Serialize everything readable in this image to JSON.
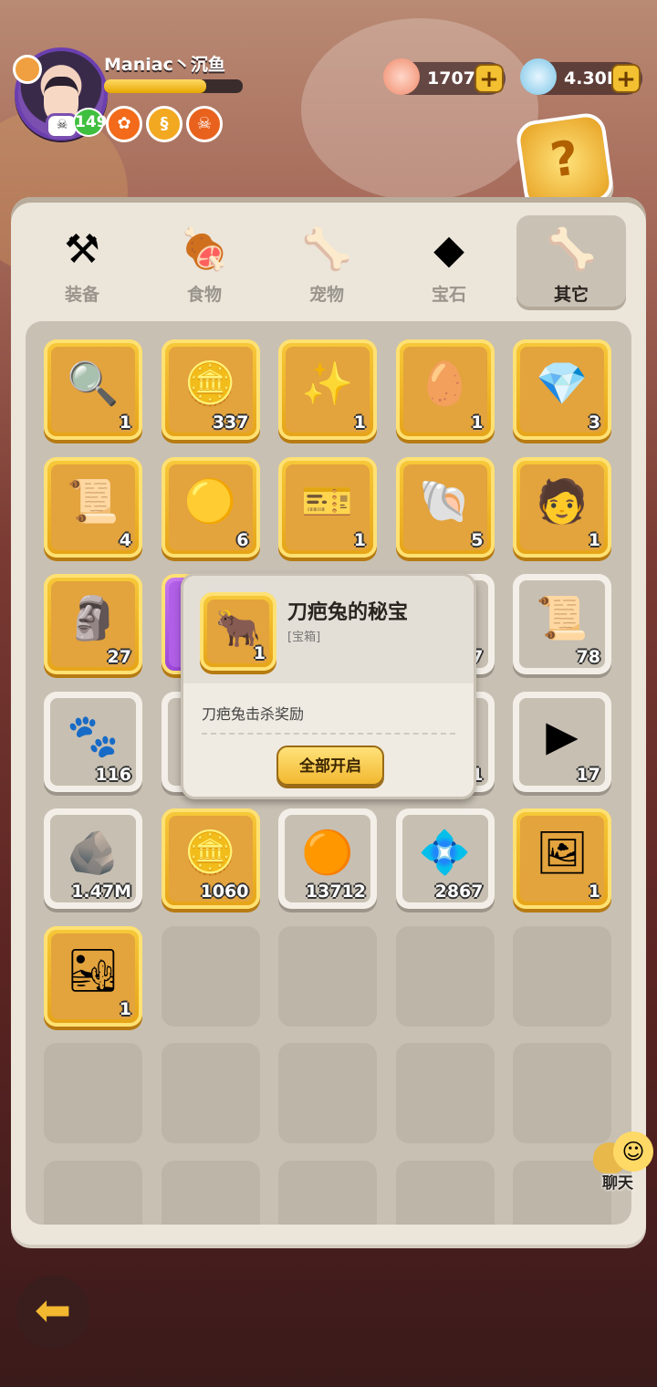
{
  "player": {
    "name": "Maniac丶沉鱼",
    "level": "149",
    "exp_fraction": 0.74,
    "buffs": [
      {
        "icon": "flower-icon",
        "color": "#f26a1a",
        "glyph": "✿"
      },
      {
        "icon": "coin-swirl-icon",
        "color": "#f2a820",
        "glyph": "§"
      },
      {
        "icon": "skull-badge-icon",
        "color": "#e8621e",
        "glyph": "☠"
      }
    ]
  },
  "currencies": [
    {
      "name": "shell-icon",
      "value": "1707"
    },
    {
      "name": "crystal-icon",
      "value": "4.30M"
    }
  ],
  "tabs": [
    {
      "label": "装备",
      "icon": "hammer-icon",
      "glyph": "⚒"
    },
    {
      "label": "食物",
      "icon": "food-bowl-icon",
      "glyph": "🍖"
    },
    {
      "label": "宠物",
      "icon": "dino-skull-icon",
      "glyph": "🦴"
    },
    {
      "label": "宝石",
      "icon": "gem-icon",
      "glyph": "◆"
    },
    {
      "label": "其它",
      "icon": "bone-icon",
      "glyph": "🦴"
    }
  ],
  "active_tab": 4,
  "items": [
    {
      "icon": "magnifier-icon",
      "glyph": "🔍",
      "count": "1",
      "frame": "gold"
    },
    {
      "icon": "gold-coin-icon",
      "glyph": "🪙",
      "count": "337",
      "frame": "gold"
    },
    {
      "icon": "glowing-chest-icon",
      "glyph": "✨",
      "count": "1",
      "frame": "gold"
    },
    {
      "icon": "egg-nest-icon",
      "glyph": "🥚",
      "count": "1",
      "frame": "gold"
    },
    {
      "icon": "treasure-chest-icon",
      "glyph": "💎",
      "count": "3",
      "frame": "gold"
    },
    {
      "icon": "blue-scroll-icon",
      "glyph": "📜",
      "count": "4",
      "frame": "gold"
    },
    {
      "icon": "gold-nugget-icon",
      "glyph": "🟡",
      "count": "6",
      "frame": "gold"
    },
    {
      "icon": "blue-ticket-icon",
      "glyph": "🎫",
      "count": "1",
      "frame": "gold"
    },
    {
      "icon": "shell-coin-icon",
      "glyph": "🐚",
      "count": "5",
      "frame": "gold"
    },
    {
      "icon": "character-card-icon",
      "glyph": "🧑",
      "count": "1",
      "frame": "gold"
    },
    {
      "icon": "idol-statue-icon",
      "glyph": "🗿",
      "count": "27",
      "frame": "gold"
    },
    {
      "icon": "purple-item-icon",
      "glyph": "",
      "count": "",
      "frame": "purple"
    },
    {
      "icon": "hidden-item-icon",
      "glyph": "",
      "count": "",
      "frame": "white"
    },
    {
      "icon": "hidden-item-icon",
      "glyph": "",
      "count": "7",
      "frame": "white"
    },
    {
      "icon": "orange-scroll-icon",
      "glyph": "📜",
      "count": "78",
      "frame": "white"
    },
    {
      "icon": "paw-ticket-icon",
      "glyph": "🐾",
      "count": "116",
      "frame": "white"
    },
    {
      "icon": "hidden-item-icon",
      "glyph": "",
      "count": "",
      "frame": "white"
    },
    {
      "icon": "hidden-item-icon",
      "glyph": "",
      "count": "",
      "frame": "white"
    },
    {
      "icon": "hidden-item-icon",
      "glyph": "",
      "count": "1",
      "frame": "white"
    },
    {
      "icon": "play-ticket-icon",
      "glyph": "▶",
      "count": "17",
      "frame": "white"
    },
    {
      "icon": "rune-stone-icon",
      "glyph": "🪨",
      "count": "1.47M",
      "frame": "white"
    },
    {
      "icon": "rune-coin-icon",
      "glyph": "🪙",
      "count": "1060",
      "frame": "gold"
    },
    {
      "icon": "bronze-coin-icon",
      "glyph": "🟠",
      "count": "13712",
      "frame": "white"
    },
    {
      "icon": "prism-crystal-icon",
      "glyph": "💠",
      "count": "2867",
      "frame": "white"
    },
    {
      "icon": "sonic-card-icon",
      "glyph": "🖼",
      "count": "1",
      "frame": "gold"
    },
    {
      "icon": "desert-map-icon",
      "glyph": "🏜",
      "count": "1",
      "frame": "gold"
    }
  ],
  "popup": {
    "title": "刀疤兔的秘宝",
    "type": "[宝箱]",
    "count": "1",
    "description": "刀疤兔击杀奖励",
    "button": "全部开启"
  },
  "chat": {
    "label": "聊天"
  },
  "colors": {
    "gold_frame": "#f2b830",
    "panel": "#ebe5da",
    "active_tab": "#c9c1b4"
  }
}
